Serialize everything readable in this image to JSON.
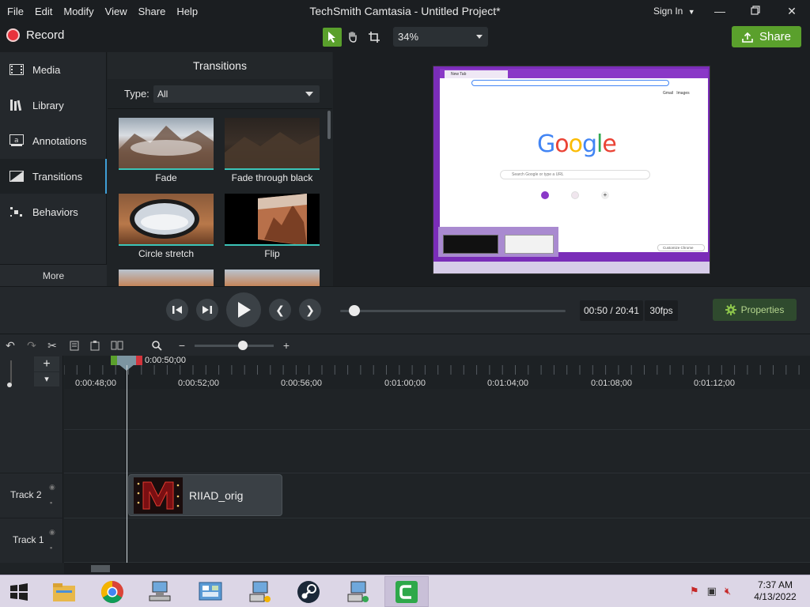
{
  "window": {
    "title": "TechSmith Camtasia - Untitled Project*",
    "menu": [
      "File",
      "Edit",
      "Modify",
      "View",
      "Share",
      "Help"
    ],
    "sign_in": "Sign In"
  },
  "toolbar": {
    "record_label": "Record",
    "zoom_value": "34%",
    "share_label": "Share",
    "accent_green": "#5aa02c"
  },
  "nav": {
    "items": [
      {
        "label": "Media",
        "icon": "film-icon"
      },
      {
        "label": "Library",
        "icon": "library-icon"
      },
      {
        "label": "Annotations",
        "icon": "annotation-icon"
      },
      {
        "label": "Transitions",
        "icon": "transition-icon"
      },
      {
        "label": "Behaviors",
        "icon": "behaviors-icon"
      }
    ],
    "active": "Transitions",
    "more_label": "More"
  },
  "transitions": {
    "title": "Transitions",
    "type_label": "Type:",
    "type_value": "All",
    "items": [
      {
        "label": "Fade"
      },
      {
        "label": "Fade through black"
      },
      {
        "label": "Circle stretch"
      },
      {
        "label": "Flip"
      }
    ]
  },
  "preview": {
    "browser_tab": "New Tab",
    "google_links": [
      "Gmail",
      "Images"
    ],
    "search_placeholder": "Search Google or type a URL",
    "customize_label": "Customize Chrome",
    "logo_colors": [
      "#4285f4",
      "#ea4335",
      "#fbbc05",
      "#4285f4",
      "#34a853",
      "#ea4335"
    ]
  },
  "playback": {
    "timecode": "00:50 / 20:41",
    "fps": "30fps",
    "properties_label": "Properties",
    "progress_fraction": 0.04
  },
  "timeline": {
    "playhead_time": "0:00:50;00",
    "ruler_labels": [
      "0:00:48;00",
      "0:00:52;00",
      "0:00:56;00",
      "0:01:00;00",
      "0:01:04;00",
      "0:01:08;00",
      "0:01:12;00"
    ],
    "tracks": [
      {
        "name": "Track 2",
        "clip": "RIIAD_orig"
      },
      {
        "name": "Track 1",
        "clip": ""
      }
    ]
  },
  "taskbar": {
    "time": "7:37 AM",
    "date": "4/13/2022",
    "apps": [
      "start-icon",
      "file-explorer-icon",
      "chrome-icon",
      "network-icon",
      "control-panel-icon",
      "computer-icon",
      "steam-icon",
      "network-computer-icon",
      "camtasia-icon"
    ]
  }
}
